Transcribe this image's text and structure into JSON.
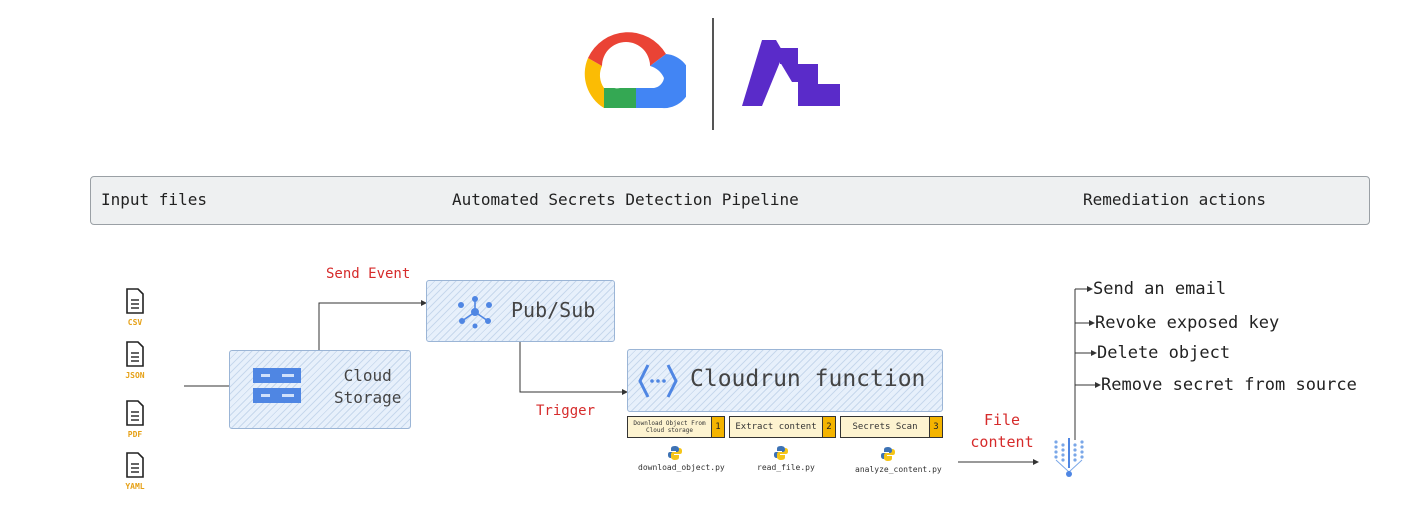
{
  "header": {
    "left": "Input files",
    "center": "Automated Secrets Detection Pipeline",
    "right": "Remediation actions"
  },
  "logos": {
    "left": "google-cloud-logo",
    "right_wordmark": "ai"
  },
  "inputs": [
    {
      "label": "CSV"
    },
    {
      "label": "JSON"
    },
    {
      "label": "PDF"
    },
    {
      "label": "YAML"
    }
  ],
  "storage": {
    "line1": "Cloud",
    "line2": "Storage"
  },
  "pubsub": {
    "label": "Pub/Sub"
  },
  "cloudrun": {
    "label": "Cloudrun function"
  },
  "edges": {
    "send_event": "Send Event",
    "trigger": "Trigger",
    "file_content_1": "File",
    "file_content_2": "content"
  },
  "steps": [
    {
      "label": "Download Object From Cloud storage",
      "num": "1",
      "script": "download_object.py"
    },
    {
      "label": "Extract content",
      "num": "2",
      "script": "read_file.py"
    },
    {
      "label": "Secrets Scan",
      "num": "3",
      "script": "analyze_content.py"
    }
  ],
  "actions": [
    "Send an email",
    "Revoke exposed key",
    "Delete object",
    "Remove secret from source"
  ],
  "colors": {
    "google_red": "#ea4335",
    "google_yellow": "#fbbc04",
    "google_green": "#34a853",
    "google_blue": "#4285f4",
    "brand_purple": "#5a2bc9",
    "edge_label": "#d62b2b",
    "step_fill": "#fdf3d0",
    "step_num": "#f4b400"
  }
}
